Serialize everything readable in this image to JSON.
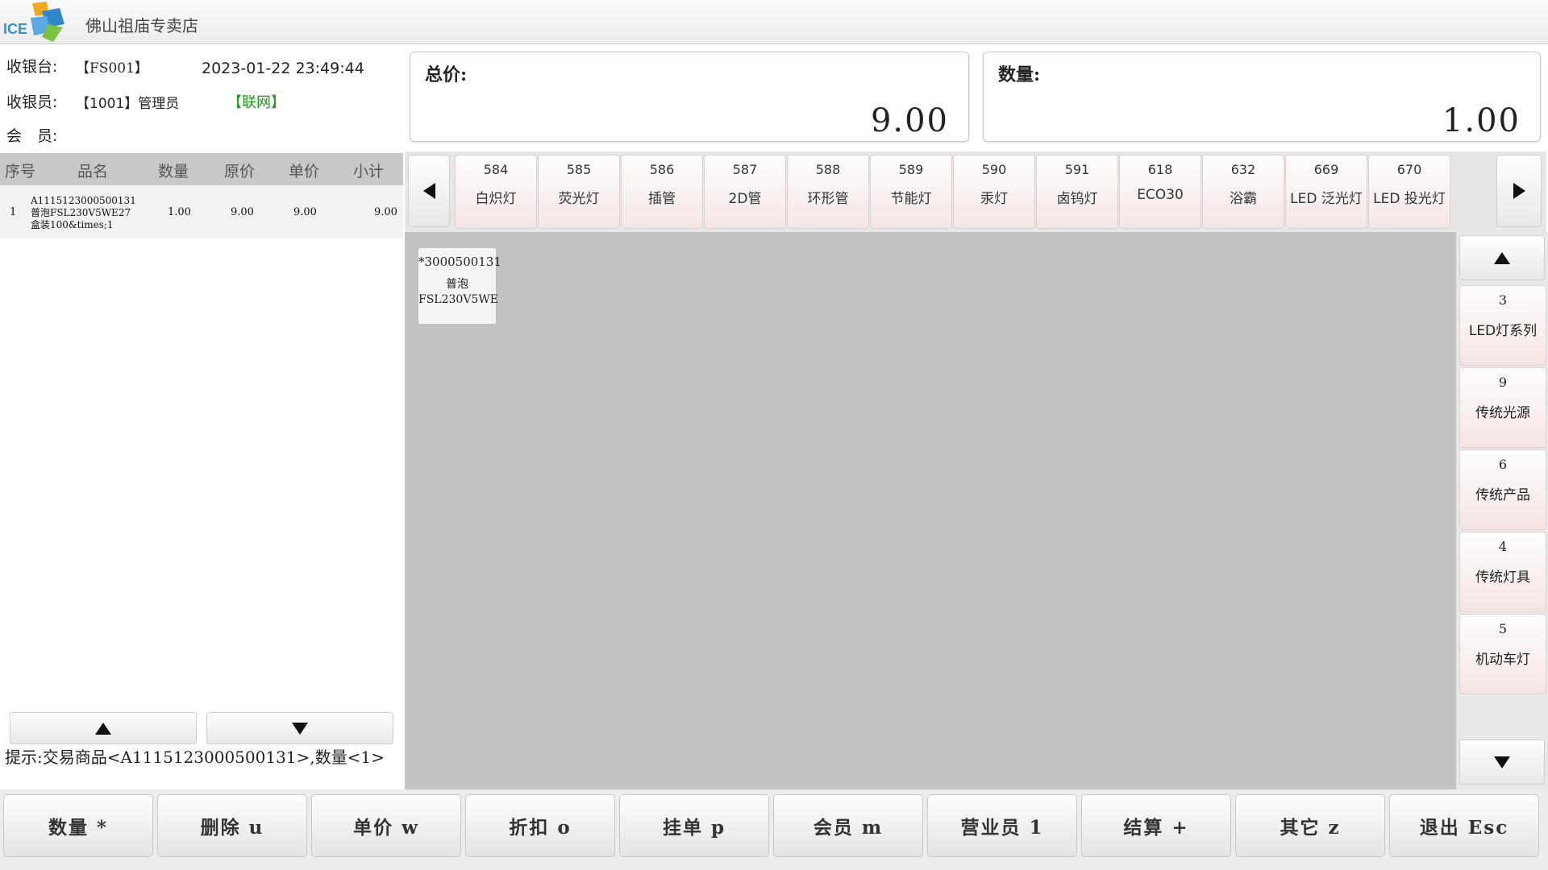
{
  "app": {
    "store_name": "佛山祖庙专卖店",
    "logo_text": "ICE"
  },
  "info": {
    "register_label": "收银台:",
    "register_value": "【FS001】",
    "datetime": "2023-01-22 23:49:44",
    "cashier_label": "收银员:",
    "cashier_value": "【1001】管理员",
    "network_status": "【联网】",
    "member_label": "会　员:",
    "member_value": ""
  },
  "totals": {
    "total_label": "总价:",
    "total_value": "9.00",
    "qty_label": "数量:",
    "qty_value": "1.00"
  },
  "cart": {
    "columns": [
      "序号",
      "品名",
      "数量",
      "原价",
      "单价",
      "小计"
    ],
    "rows": [
      {
        "index": "1",
        "name_lines": [
          "A1115123000500131",
          "普泡FSL230V5WE27",
          "盒装100&times;1"
        ],
        "qty": "1.00",
        "orig_price": "9.00",
        "unit_price": "9.00",
        "subtotal": "9.00"
      }
    ]
  },
  "hint": "提示:交易商品<A1115123000500131>,数量<1>",
  "categories": [
    {
      "code": "584",
      "name": "白炽灯"
    },
    {
      "code": "585",
      "name": "荧光灯"
    },
    {
      "code": "586",
      "name": "插管"
    },
    {
      "code": "587",
      "name": "2D管"
    },
    {
      "code": "588",
      "name": "环形管"
    },
    {
      "code": "589",
      "name": "节能灯"
    },
    {
      "code": "590",
      "name": "汞灯"
    },
    {
      "code": "591",
      "name": "卤钨灯"
    },
    {
      "code": "618",
      "name": "ECO30"
    },
    {
      "code": "632",
      "name": "浴霸"
    },
    {
      "code": "669",
      "name": "LED 泛光灯"
    },
    {
      "code": "670",
      "name": "LED 投光灯"
    }
  ],
  "products": [
    {
      "code": "*3000500131",
      "name_line1": "普泡",
      "name_line2": "FSL230V5WE"
    }
  ],
  "groups": [
    {
      "code": "3",
      "name": "LED灯系列"
    },
    {
      "code": "9",
      "name": "传统光源"
    },
    {
      "code": "6",
      "name": "传统产品"
    },
    {
      "code": "4",
      "name": "传统灯具"
    },
    {
      "code": "5",
      "name": "机动车灯"
    }
  ],
  "functions": [
    {
      "label": "数量 *"
    },
    {
      "label": "删除 u"
    },
    {
      "label": "单价 w"
    },
    {
      "label": "折扣 o"
    },
    {
      "label": "挂单 p"
    },
    {
      "label": "会员 m"
    },
    {
      "label": "营业员 1"
    },
    {
      "label": "结算 +"
    },
    {
      "label": "其它 z"
    },
    {
      "label": "退出 Esc"
    }
  ],
  "colors": {
    "online_green": "#1f9a1f",
    "product_area_bg": "#c2c2c2",
    "button_pink_tint": "#f5e6e6"
  }
}
